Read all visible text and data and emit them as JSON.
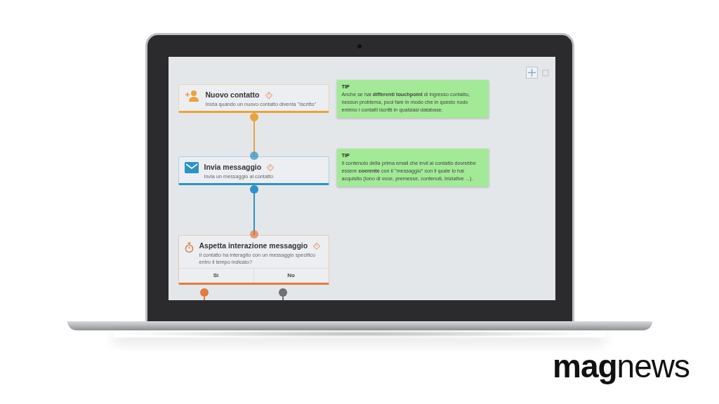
{
  "toolbar": [
    {
      "kind": "move",
      "selected": true
    },
    {
      "kind": "square",
      "selected": false
    }
  ],
  "nodes": [
    {
      "kind": "contact",
      "title": "Nuovo contatto",
      "description": "Inizia quando un nuovo contatto diventa \"Iscritto\"",
      "color": "#e8a33d"
    },
    {
      "kind": "message",
      "title": "Invia messaggio",
      "description": "Invia un messaggio al contatto",
      "color": "#2b93c8"
    },
    {
      "kind": "wait",
      "title": "Aspetta interazione messaggio",
      "description": "Il contatto ha interagito con un messaggio specifico entro il tempo indicato?",
      "color": "#e27b3f",
      "branches": [
        {
          "label": "Sì",
          "color": "#e27b3f"
        },
        {
          "label": "No",
          "color": "#6d6f73"
        }
      ]
    }
  ],
  "tips": [
    {
      "label": "TIP",
      "text": "Anche se hai **differenti touchpoint** di ingresso contatto, nessun problema, puoi fare in modo che in questo nodo entrino i contatti iscritti in qualsiasi database."
    },
    {
      "label": "TIP",
      "text": "Il contenuto della prima email che invii al contatto dovrebbe essere **coerente** con il \"messaggio\" con il quale lo hai acquisito (tono di voce, premesse, contenuti, iniziative ...)."
    }
  ],
  "logo": {
    "bold": "mag",
    "light": "news"
  }
}
